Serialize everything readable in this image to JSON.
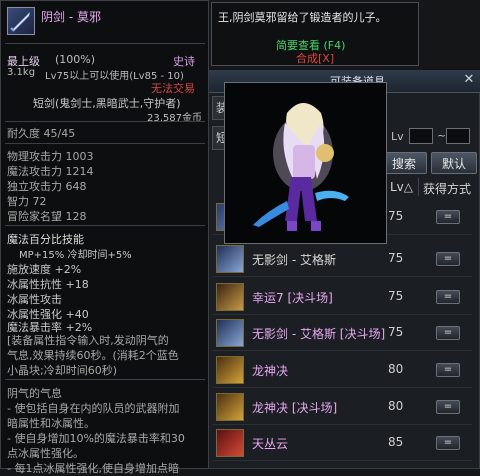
{
  "tooltip": {
    "item_name": "阴剑 - 莫邪",
    "grade": "最上级",
    "grade_pct": "(100%)",
    "rarity": "史诗",
    "weight": "3.1kg",
    "level_req": "Lv75以上可以使用(Lv85 - 10)",
    "no_trade": "无法交易",
    "type": "短剑(鬼剑士,黑暗武士,守护者)",
    "price": "23,587金币",
    "durability": "耐久度 45/45",
    "stats": [
      "物理攻击力 1003",
      "魔法攻击力 1214",
      "独立攻击力 648",
      "智力 72",
      "冒险家名望 128"
    ],
    "skill_header": "魔法百分比技能",
    "mp_line": "MP+15% 冷却时间+5%",
    "attrs": [
      "施放速度 +2%",
      "冰属性抗性 +18",
      "冰属性攻击",
      "冰属性强化 +40",
      "魔法暴击率 +2%"
    ],
    "equip_desc": [
      "[装备属性指令输入时,发动阴气的",
      "气息,效果持续60秒。(消耗2个蓝色",
      "小晶块;冷却时间60秒)"
    ],
    "aura_title": "阴气的气息",
    "aura_desc": [
      "- 使包括自身在内的队员的武器附加",
      "暗属性和冰属性。",
      "- 使自身增加10%的魔法暴击率和30",
      "点冰属性强化。",
      "- 每1点冰属性强化,使自身增加点暗"
    ]
  },
  "description_box": {
    "line": "王,阴剑莫邪留给了锻造者的儿子。",
    "brief_view": "简要查看 (F4)",
    "synthesis": "合成[X]"
  },
  "search_window": {
    "title": "可装备道具",
    "tab_frag_1": "装",
    "tab_frag_2": "短",
    "lv_label": "Lv",
    "lv_min": "",
    "lv_max": "",
    "lv_tilde": "~",
    "search_btn": "搜索",
    "default_btn": "默认",
    "col_lv": "Lv△",
    "col_method": "获得方式",
    "detail_btn": "=",
    "rows": [
      {
        "name": "",
        "lv": "75",
        "color": "#d9d9d9",
        "icon": "sword-icon"
      },
      {
        "name": "无影剑 - 艾格斯",
        "lv": "75",
        "color": "#d9d9d9",
        "icon": "sword-icon"
      },
      {
        "name": "幸运7 [决斗场]",
        "lv": "75",
        "color": "#e6a8f0",
        "icon": "sword-icon"
      },
      {
        "name": "无影剑 - 艾格斯 [决斗场]",
        "lv": "75",
        "color": "#e6a8f0",
        "icon": "sword-icon"
      },
      {
        "name": "龙神决",
        "lv": "80",
        "color": "#e6a8f0",
        "icon": "sword-icon"
      },
      {
        "name": "龙神决 [决斗场]",
        "lv": "80",
        "color": "#e6a8f0",
        "icon": "sword-icon"
      },
      {
        "name": "天丛云",
        "lv": "85",
        "color": "#e6a8f0",
        "icon": "sword-icon"
      }
    ]
  },
  "colors": {
    "epic": "#e6a8f0",
    "no_trade": "#d64646",
    "brief_view": "#49d36e"
  }
}
